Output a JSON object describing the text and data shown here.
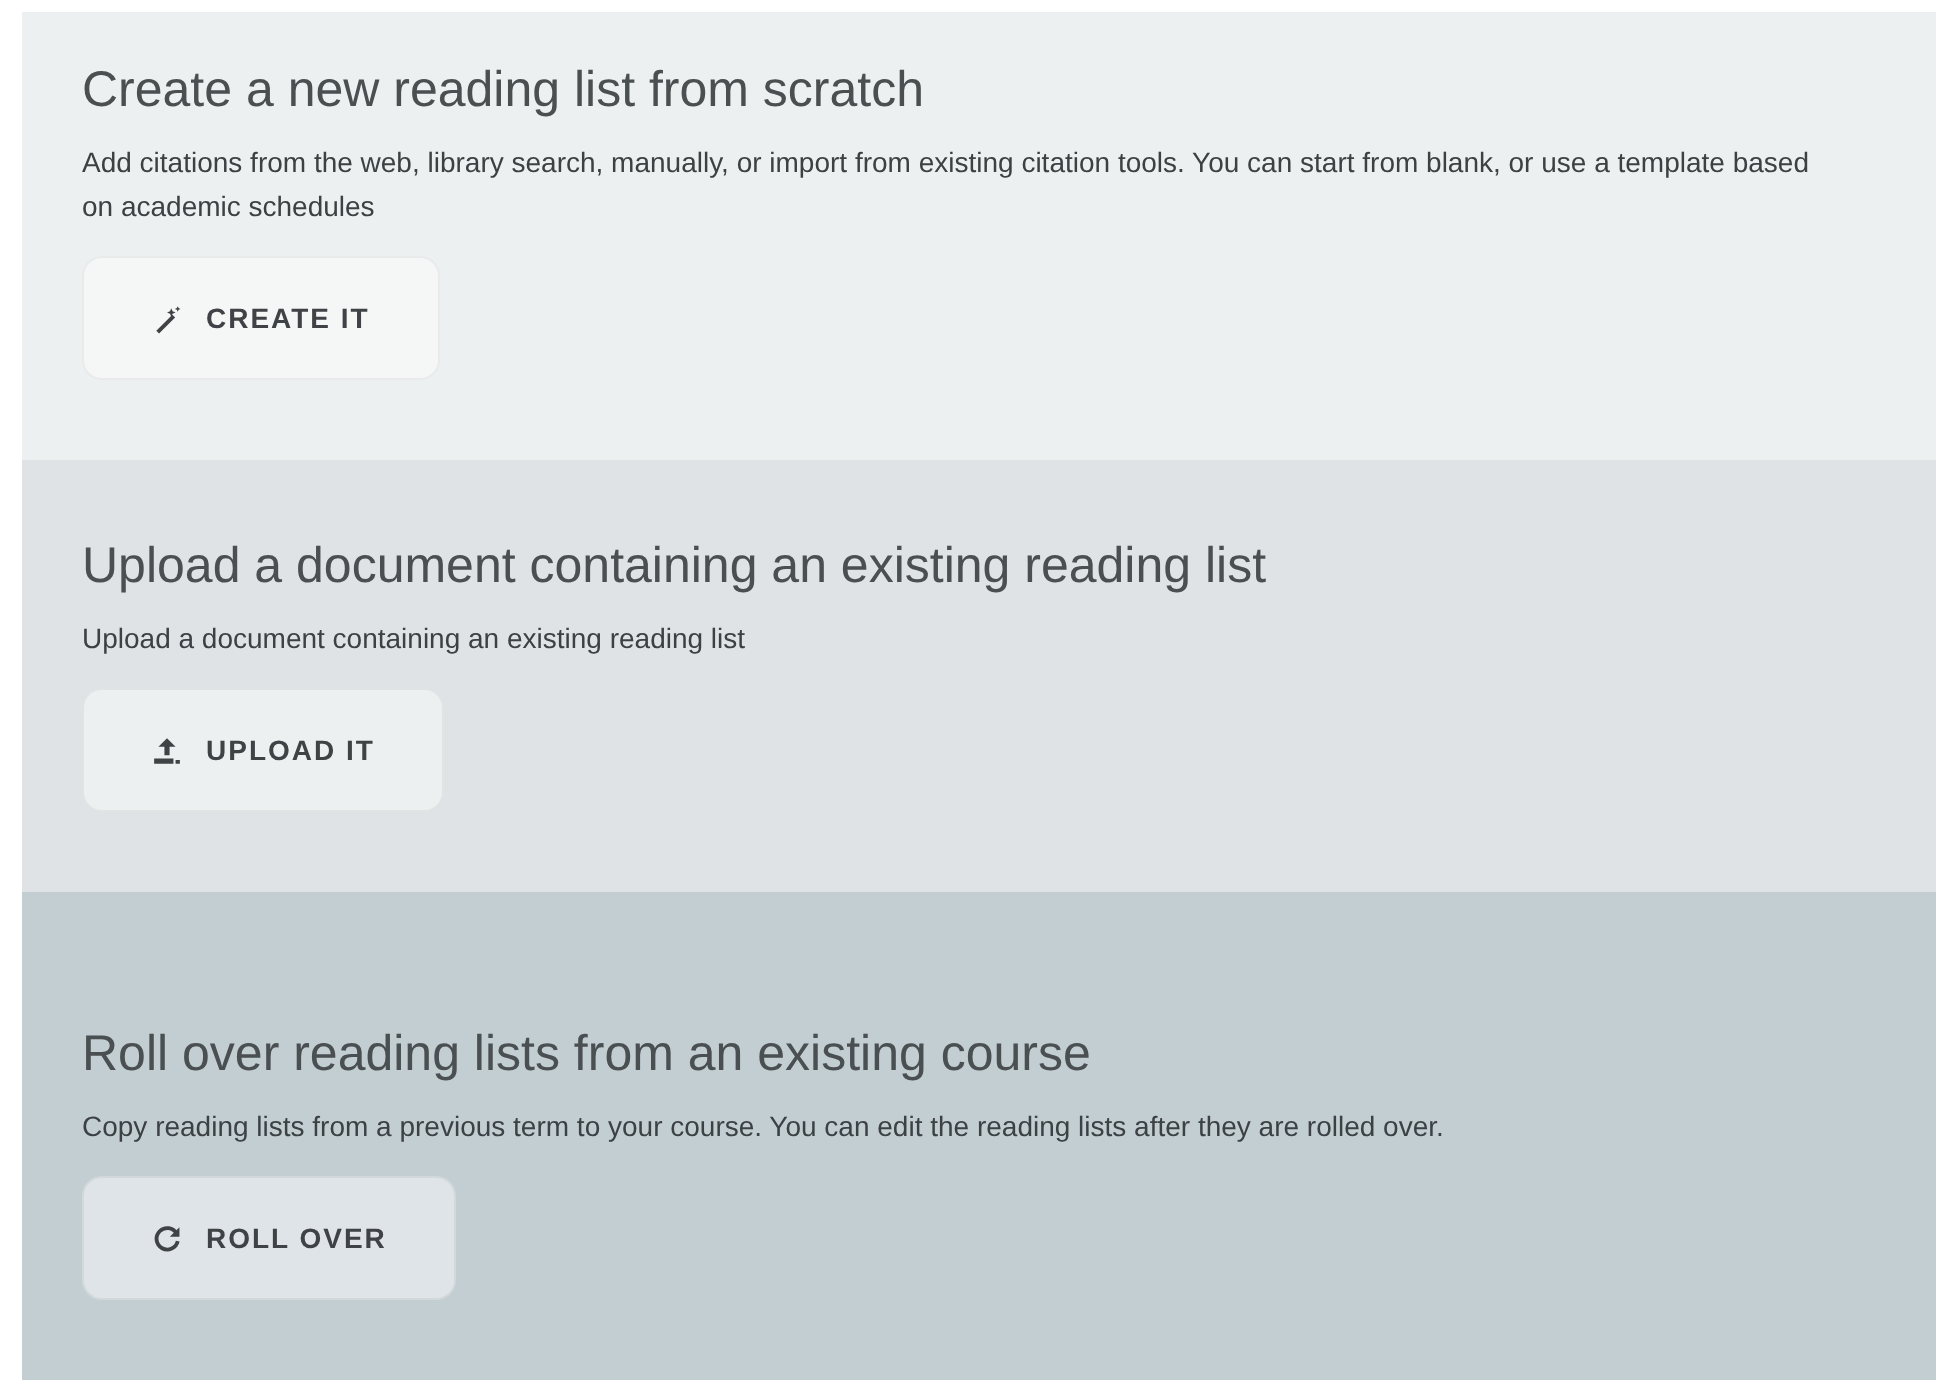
{
  "sections": [
    {
      "title": "Create a new reading list from scratch",
      "description": "Add citations from the web, library search, manually, or import from existing citation tools. You can start from blank, or use a template based on academic schedules",
      "button": {
        "label": "CREATE IT",
        "kind": "wand"
      },
      "color": "#edf0f1"
    },
    {
      "title": "Upload a document containing an existing reading list",
      "description": "Upload a document containing an existing reading list",
      "button": {
        "label": "UPLOAD IT",
        "kind": "upload"
      },
      "color": "#dfe3e6"
    },
    {
      "title": "Roll over reading lists from an existing course",
      "description": "Copy reading lists from a previous term to your course. You can edit the reading lists after they are rolled over.",
      "button": {
        "label": "ROLL OVER",
        "kind": "refresh"
      },
      "color": "#c3ced3"
    }
  ]
}
